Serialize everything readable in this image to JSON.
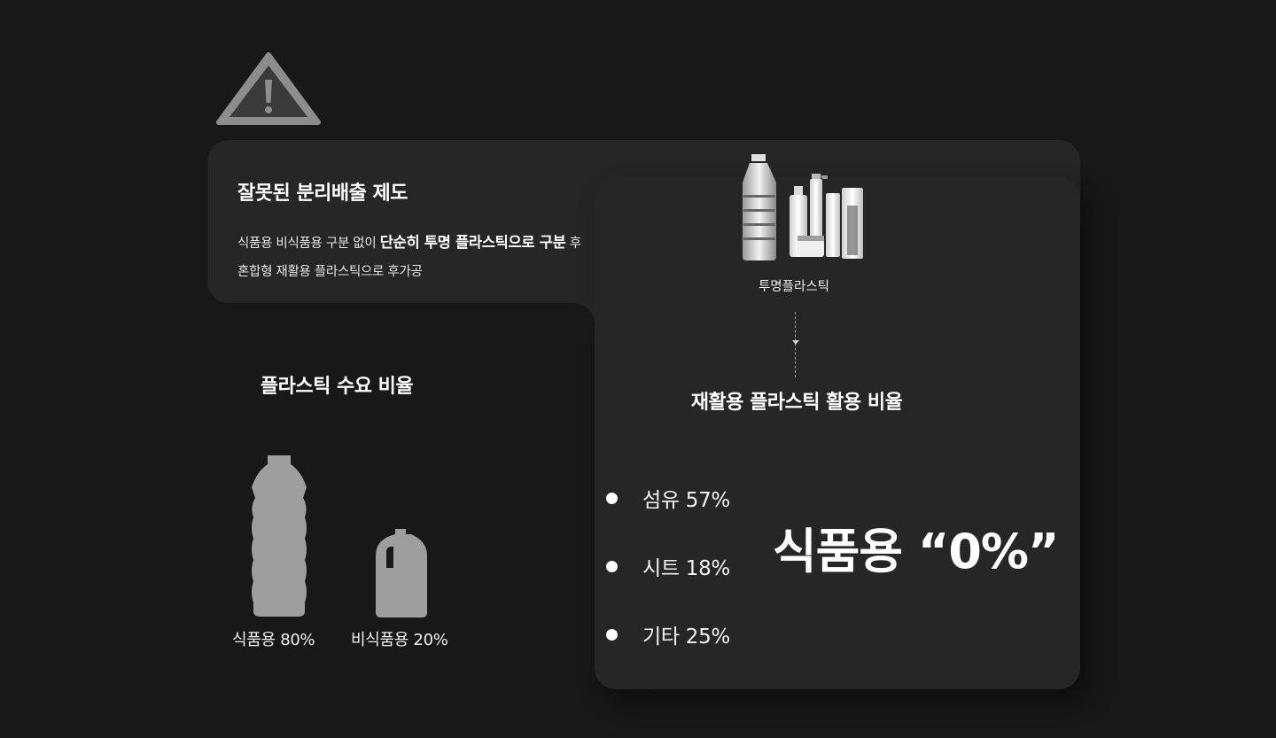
{
  "warning": {
    "icon": "warning-triangle-icon"
  },
  "problem": {
    "title": "잘못된 분리배출 제도",
    "desc_part1": "식품용 비식품용 구분 없이 ",
    "desc_strong": "단순히 투명 플라스틱으로 구분",
    "desc_part2": " 후",
    "desc_line2": "혼합형 재활용 플라스틱으로 후가공"
  },
  "clear_plastic": {
    "label": "투명플라스틱",
    "image": "bottles-photo"
  },
  "recycle": {
    "title": "재활용 플라스틱 활용 비율",
    "items": [
      {
        "label": "섬유 57%"
      },
      {
        "label": "시트 18%"
      },
      {
        "label": "기타 25%"
      }
    ],
    "highlight": "식품용 “0%”"
  },
  "demand": {
    "title": "플라스틱 수요 비율",
    "food_caption": "식품용 80%",
    "nonfood_caption": "비식품용 20%",
    "food_share": 80,
    "nonfood_share": 20
  },
  "colors": {
    "background": "#181818",
    "panel": "#262626",
    "icon_gray": "#9e9e9e",
    "text": "#ffffff"
  }
}
